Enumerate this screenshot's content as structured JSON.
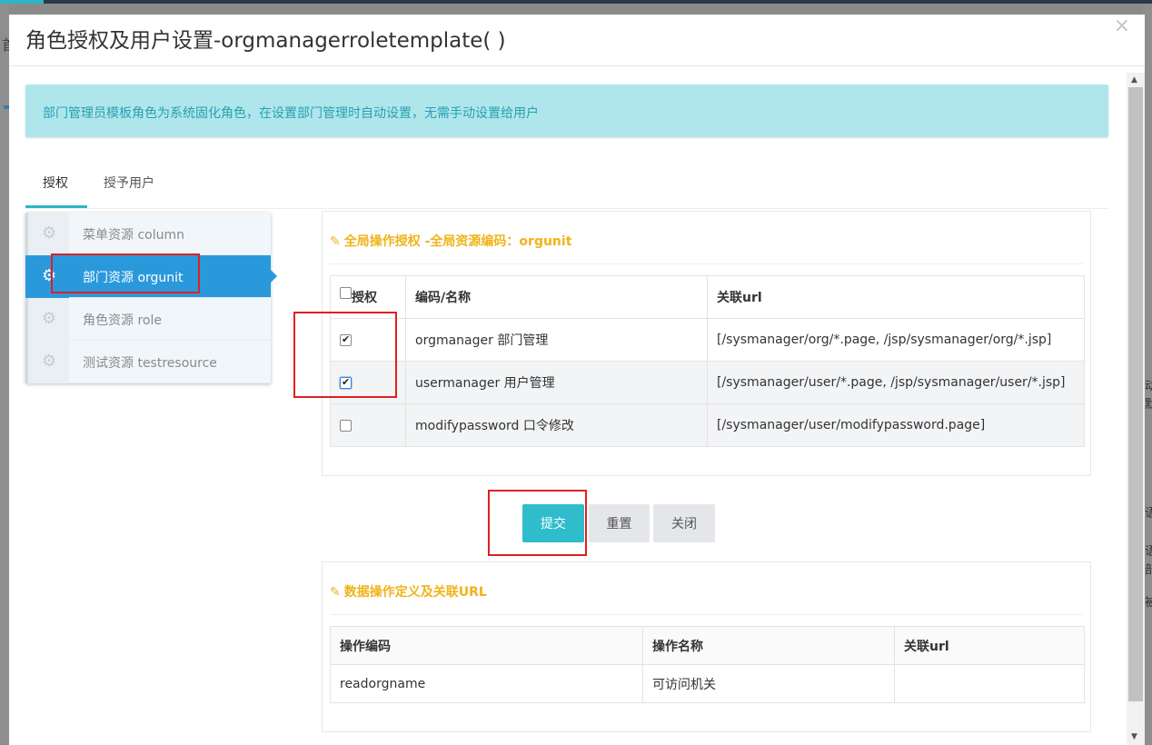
{
  "background": {
    "left_char": "首",
    "right_chars": [
      "动",
      "默",
      "语",
      "语",
      "部",
      "被"
    ]
  },
  "modal": {
    "title": "角色授权及用户设置-orgmanagerroletemplate( )",
    "close_icon": "×",
    "alert": "部门管理员模板角色为系统固化角色，在设置部门管理时自动设置，无需手动设置给用户",
    "tabs": [
      {
        "label": "授权",
        "active": true
      },
      {
        "label": "授予用户",
        "active": false
      }
    ],
    "resources": [
      {
        "icon": "gear-icon",
        "label": "菜单资源 column",
        "active": false
      },
      {
        "icon": "gear-icon",
        "label": "部门资源 orgunit",
        "active": true
      },
      {
        "icon": "gear-icon",
        "label": "角色资源 role",
        "active": false
      },
      {
        "icon": "gear-icon",
        "label": "测试资源 testresource",
        "active": false
      }
    ],
    "global_panel": {
      "pin_icon": "pin-icon",
      "title": "全局操作授权 -全局资源编码：orgunit",
      "headers": {
        "auth": "授权",
        "code": "编码/名称",
        "url": "关联url"
      },
      "rows": [
        {
          "checked": true,
          "code": "orgmanager 部门管理",
          "url": "[/sysmanager/org/*.page, /jsp/sysmanager/org/*.jsp]"
        },
        {
          "checked": true,
          "code": "usermanager 用户管理",
          "url": "[/sysmanager/user/*.page, /jsp/sysmanager/user/*.jsp]"
        },
        {
          "checked": false,
          "code": "modifypassword 口令修改",
          "url": "[/sysmanager/user/modifypassword.page]"
        }
      ]
    },
    "buttons": {
      "submit": "提交",
      "reset": "重置",
      "close": "关闭"
    },
    "data_panel": {
      "pin_icon": "pin-icon",
      "title": "数据操作定义及关联URL",
      "headers": {
        "code": "操作编码",
        "name": "操作名称",
        "url": "关联url"
      },
      "rows": [
        {
          "code": "readorgname",
          "name": "可访问机关",
          "url": ""
        }
      ]
    },
    "colors": {
      "accent": "#2fbdcb",
      "active_menu": "#2a99dc",
      "panel_title": "#f0b31a",
      "alert_bg": "#aee6ec",
      "highlight": "#e02020"
    }
  }
}
